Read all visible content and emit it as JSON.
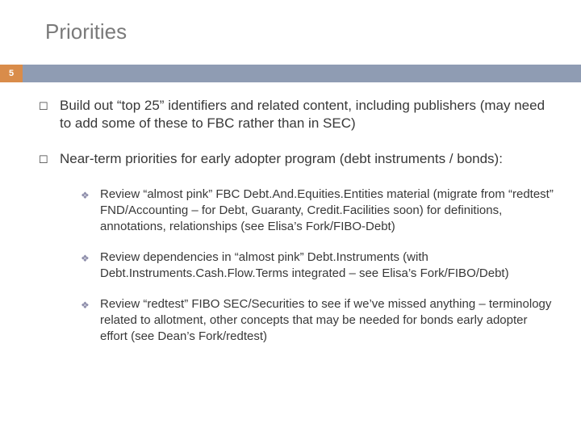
{
  "title": "Priorities",
  "page_number": "5",
  "bullets": [
    {
      "text": "Build out “top 25” identifiers and related content, including publishers (may need to add some of these to FBC rather than in SEC)"
    },
    {
      "text": "Near-term priorities for early adopter program (debt instruments / bonds):",
      "sub": [
        "Review “almost pink” FBC Debt.And.Equities.Entities material (migrate from “redtest” FND/Accounting – for Debt, Guaranty, Credit.Facilities soon) for definitions, annotations, relationships (see Elisa’s Fork/FIBO-Debt)",
        "Review dependencies in “almost pink” Debt.Instruments (with Debt.Instruments.Cash.Flow.Terms integrated – see Elisa’s Fork/FIBO/Debt)",
        "Review “redtest” FIBO SEC/Securities to see if we’ve missed anything – terminology related to allotment, other concepts that may be needed for bonds early adopter effort (see Dean’s Fork/redtest)"
      ]
    }
  ]
}
